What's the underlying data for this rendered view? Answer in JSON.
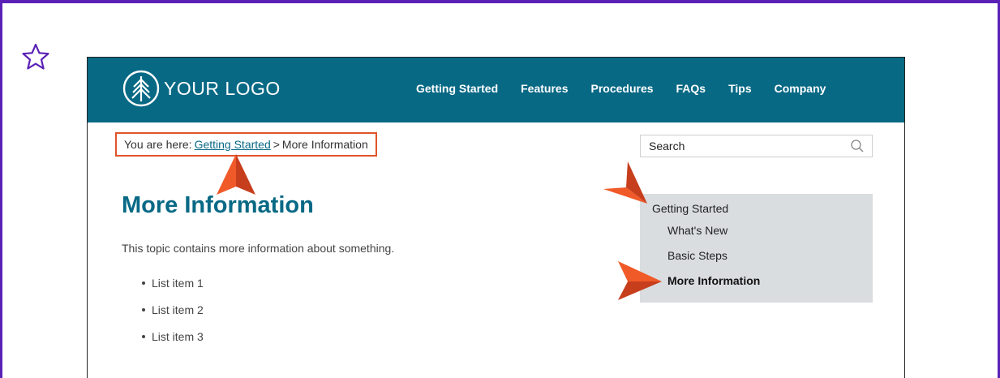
{
  "colors": {
    "frame": "#5b21b6",
    "header_bg": "#086985",
    "accent": "#e0542a",
    "sidebar_bg": "#d9dde0"
  },
  "icons": {
    "favorite": "star-icon",
    "logo": "tree-logo-icon",
    "search": "search-icon",
    "callout": "arrow-callout-icon"
  },
  "header": {
    "logo_text": "YOUR LOGO",
    "nav": [
      "Getting Started",
      "Features",
      "Procedures",
      "FAQs",
      "Tips",
      "Company"
    ]
  },
  "breadcrumb": {
    "prefix": "You are here:",
    "link": "Getting Started",
    "separator": ">",
    "current": "More Information"
  },
  "search": {
    "placeholder": "Search"
  },
  "main": {
    "title": "More Information",
    "intro": "This topic contains more information about something.",
    "list": [
      "List item 1",
      "List item 2",
      "List item 3"
    ]
  },
  "sidebar": {
    "parent": "Getting Started",
    "children": [
      "What's New",
      "Basic Steps",
      "More Information"
    ],
    "active_child": "More Information"
  }
}
